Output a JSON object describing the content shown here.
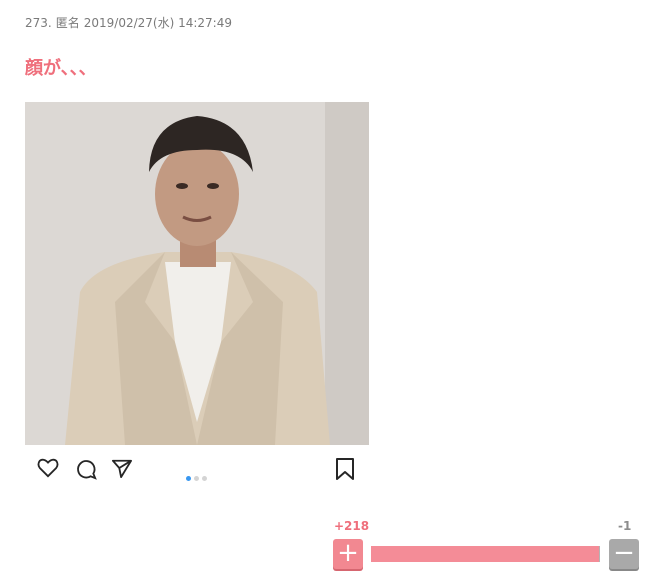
{
  "post": {
    "number": "273.",
    "author": "匿名",
    "date": "2019/02/27(水) 14:27:49",
    "comment": "顔が、、、"
  },
  "instagram": {
    "icons": [
      "heart-icon",
      "comment-icon",
      "share-icon",
      "bookmark-icon"
    ],
    "carousel_pages": 3,
    "carousel_active_index": 0
  },
  "votes": {
    "plus": "+218",
    "minus": "-1",
    "plus_button_label": "+",
    "minus_button_label": "−",
    "plus_ratio": 0.995,
    "plus_color": "#f28891",
    "minus_color": "#a9a9a9"
  }
}
